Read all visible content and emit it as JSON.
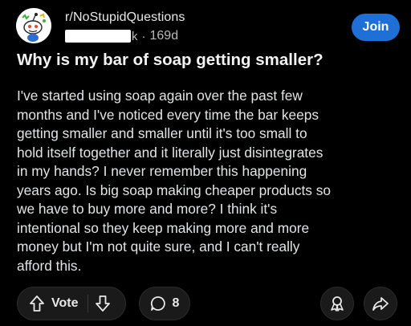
{
  "post": {
    "subreddit": "r/NoStupidQuestions",
    "username_visible_tail": "k",
    "separator": "·",
    "age": "169d",
    "join_label": "Join",
    "title": "Why is my bar of soap getting smaller?",
    "body": "I've started using soap again over the past few\nmonths and I've noticed every time the bar keeps\ngetting smaller and smaller until it's too small to\nhold itself together and it literally just disintegrates\nin my hands? I never remember this happening\nyears ago. Is big soap making cheaper products so\nwe have to buy more and more? I think it's\nintentional so they keep making more and more\nmoney but I'm not quite sure, and I can't really\nafford this."
  },
  "actions": {
    "vote_label": "Vote",
    "comment_count": "8"
  },
  "icons": {
    "avatar": "subreddit-snoo-avatar-icon",
    "upvote": "arrow-up-icon",
    "downvote": "arrow-down-icon",
    "comment": "speech-bubble-icon",
    "award": "award-ribbon-icon",
    "share": "share-arrow-icon"
  },
  "colors": {
    "background": "#000000",
    "join_button": "#1e6fd6",
    "pill_background": "#1a1a1b",
    "text_primary": "#f2f2f2",
    "text_secondary": "#b8babc"
  }
}
